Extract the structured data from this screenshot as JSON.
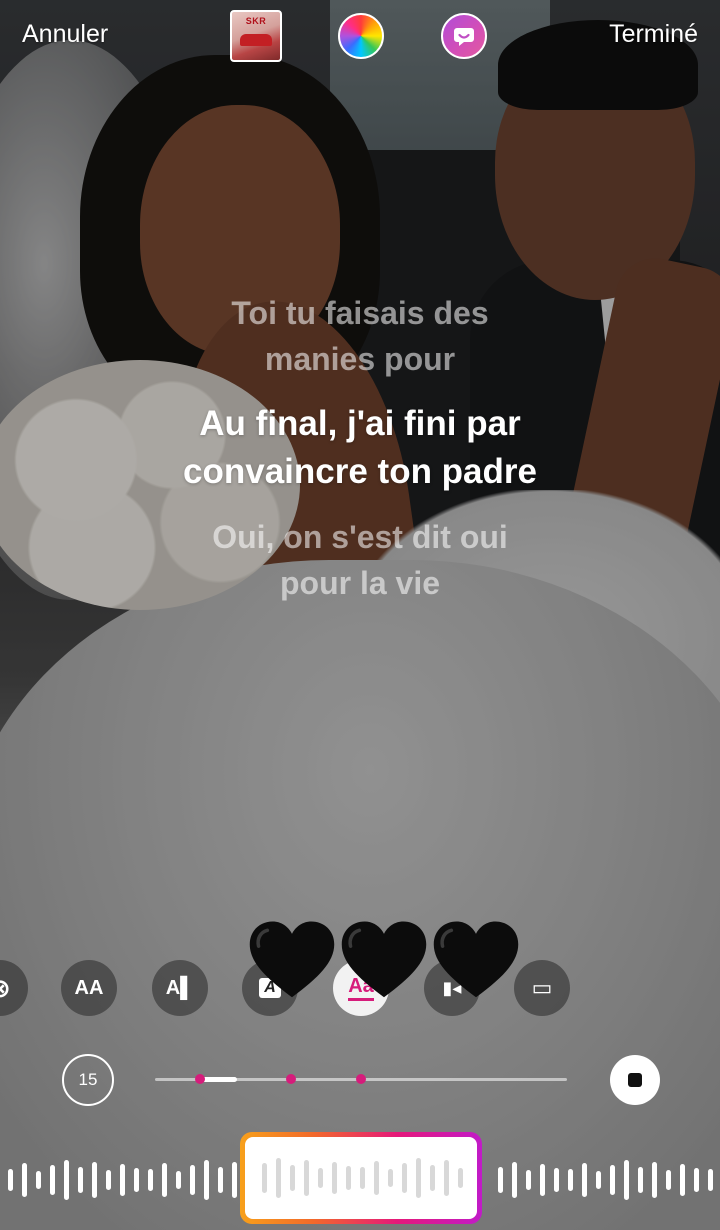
{
  "topbar": {
    "cancel_label": "Annuler",
    "done_label": "Terminé",
    "album_logo_text": "SKR",
    "album_artist_text": "",
    "icons": [
      "album-cover-thumbnail",
      "color-wheel-icon",
      "sticker-face-icon"
    ]
  },
  "lyrics": {
    "previous": [
      "Toi tu faisais des",
      "manies pour"
    ],
    "current": [
      "Au final, j'ai fini par",
      "convaincre ton padre"
    ],
    "next": [
      "Oui, on s'est dit oui",
      "pour la vie"
    ]
  },
  "emojis": {
    "hearts": [
      "🖤",
      "🖤",
      "🖤"
    ]
  },
  "style_bar": {
    "buttons": [
      {
        "name": "close-style-icon",
        "glyph": "⊗"
      },
      {
        "name": "text-size-style-icon",
        "glyph": "AA"
      },
      {
        "name": "text-bar-style-icon",
        "glyph": "A▌"
      },
      {
        "name": "text-box-style-icon",
        "glyph": "A"
      },
      {
        "name": "text-underline-style-icon",
        "glyph": "Aa",
        "active": true
      },
      {
        "name": "video-style-icon",
        "glyph": "▮◂"
      },
      {
        "name": "card-style-icon",
        "glyph": "▭"
      }
    ],
    "active_color": "#d61c7b"
  },
  "player": {
    "duration_label": "15",
    "progress_start_fraction": 0.1,
    "progress_end_fraction": 0.2,
    "markers_fraction": [
      0.11,
      0.33,
      0.5
    ],
    "marker_color": "#d61c7b"
  },
  "waveform": {
    "selection_gradient": [
      "#f7a01b",
      "#f26a2a",
      "#e5197a",
      "#c11bc8"
    ]
  }
}
